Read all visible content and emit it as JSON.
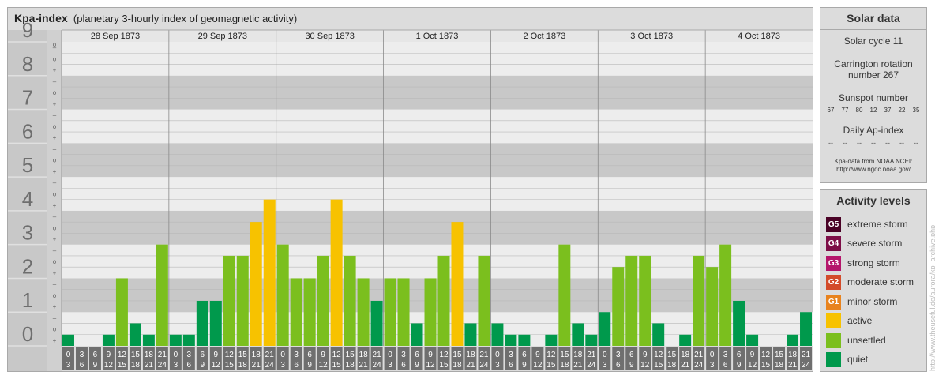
{
  "header": {
    "title": "Kpa-index",
    "subtitle": "(planetary 3-hourly index of geomagnetic activity)"
  },
  "chart_data": {
    "type": "bar",
    "title": "Kpa-index",
    "subtitle": "(planetary 3-hourly index of geomagnetic activity)",
    "ylim": [
      0,
      9
    ],
    "y_ticks": [
      "0",
      "1",
      "2",
      "3",
      "4",
      "5",
      "6",
      "7",
      "8",
      "9"
    ],
    "sub_ticks": [
      "+",
      "o",
      "–"
    ],
    "days": [
      "28 Sep 1873",
      "29 Sep 1873",
      "30 Sep 1873",
      "1 Oct 1873",
      "2 Oct 1873",
      "3 Oct 1873",
      "4 Oct 1873"
    ],
    "intervals": [
      [
        "0",
        "3"
      ],
      [
        "3",
        "6"
      ],
      [
        "6",
        "9"
      ],
      [
        "9",
        "12"
      ],
      [
        "12",
        "15"
      ],
      [
        "15",
        "18"
      ],
      [
        "18",
        "21"
      ],
      [
        "21",
        "24"
      ]
    ],
    "values": [
      0.333,
      0,
      0,
      0.333,
      2,
      0.667,
      0.333,
      3,
      0.333,
      0.333,
      1.333,
      1.333,
      2.667,
      2.667,
      3.667,
      4.333,
      3,
      2,
      2,
      2.667,
      4.333,
      2.667,
      2,
      1.333,
      2,
      2,
      0.667,
      2,
      2.667,
      3.667,
      0.667,
      2.667,
      0.667,
      0.333,
      0.333,
      0,
      0.333,
      3,
      0.667,
      0.333,
      1,
      2.333,
      2.667,
      2.667,
      0.667,
      0,
      0.333,
      2.667,
      2.333,
      3,
      1.333,
      0.333,
      0,
      0,
      0.333,
      1
    ],
    "colors": {
      "quiet": "#00994c",
      "unsettled": "#7bbf1e",
      "active": "#f7c200",
      "g1": "#e8831e",
      "g2": "#d34b2a",
      "g3": "#b5166b",
      "g4": "#7d0e47",
      "g5": "#4a0226"
    },
    "grid": true
  },
  "solar_panel": {
    "title": "Solar data",
    "solar_cycle": "Solar cycle 11",
    "carrington_line1": "Carrington rotation",
    "carrington_line2": "number 267",
    "sunspot_title": "Sunspot number",
    "sunspots": [
      "67",
      "77",
      "80",
      "12",
      "37",
      "22",
      "35"
    ],
    "ap_title": "Daily Ap-index",
    "ap_values": [
      "--",
      "--",
      "--",
      "--",
      "--",
      "--",
      "--"
    ],
    "credit_line1": "Kpa-data from NOAA NCEI:",
    "credit_line2": "http://www.ngdc.noaa.gov/"
  },
  "activity_panel": {
    "title": "Activity levels",
    "items": [
      {
        "badge": "G5",
        "label": "extreme storm",
        "color": "#4a0226"
      },
      {
        "badge": "G4",
        "label": "severe storm",
        "color": "#7d0e47"
      },
      {
        "badge": "G3",
        "label": "strong storm",
        "color": "#b5166b"
      },
      {
        "badge": "G2",
        "label": "moderate storm",
        "color": "#d34b2a"
      },
      {
        "badge": "G1",
        "label": "minor storm",
        "color": "#e8831e"
      },
      {
        "badge": "",
        "label": "active",
        "color": "#f7c200"
      },
      {
        "badge": "",
        "label": "unsettled",
        "color": "#7bbf1e"
      },
      {
        "badge": "",
        "label": "quiet",
        "color": "#00994c"
      }
    ]
  },
  "watermark": "http://www.theuseful.de/aurora/kp_archive.php"
}
